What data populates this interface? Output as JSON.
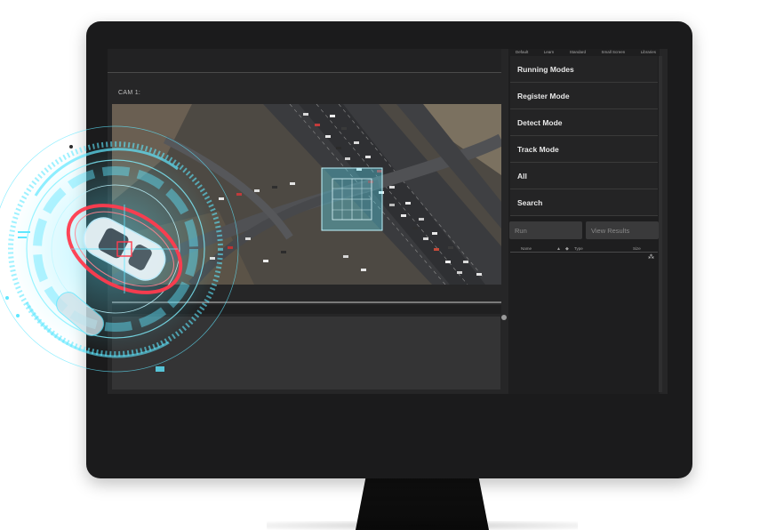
{
  "camera": {
    "label": "CAM 1:"
  },
  "presets": [
    "Default",
    "Learn",
    "Standard",
    "Small Screen",
    "Libraries"
  ],
  "menu": {
    "items": [
      {
        "label": "Running Modes"
      },
      {
        "label": "Register Mode"
      },
      {
        "label": "Detect Mode"
      },
      {
        "label": "Track Mode"
      },
      {
        "label": "All"
      },
      {
        "label": "Search"
      }
    ]
  },
  "buttons": {
    "run": "Run",
    "view_results": "View Results"
  },
  "table": {
    "headers": {
      "name": "Name",
      "type": "Type",
      "size": "Size"
    }
  },
  "colors": {
    "hud_cyan": "#5fe7ff",
    "hud_red": "#ff3b4e",
    "panel_bg": "#1e1e1f",
    "screen_bg": "#262627"
  }
}
